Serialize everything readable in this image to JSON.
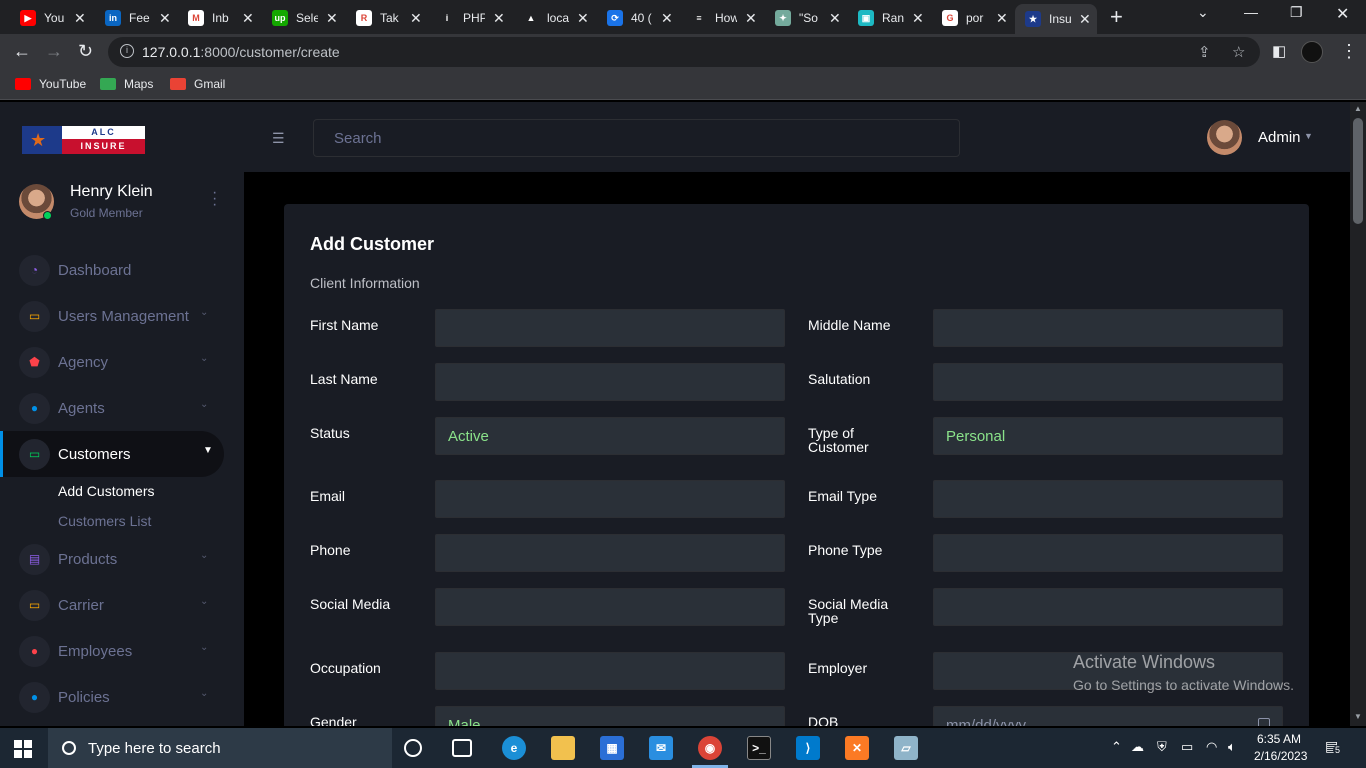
{
  "browser": {
    "tabs": [
      {
        "label": "You",
        "fav_color": "#ff0000",
        "fav_text": "▶"
      },
      {
        "label": "Fee",
        "fav_color": "#0a66c2",
        "fav_text": "in"
      },
      {
        "label": "Inb",
        "fav_color": "#ffffff",
        "fav_text": "M"
      },
      {
        "label": "Sele",
        "fav_color": "#14a800",
        "fav_text": "up"
      },
      {
        "label": "Tak",
        "fav_color": "#ffffff",
        "fav_text": "R"
      },
      {
        "label": "PHP",
        "fav_color": "#202124",
        "fav_text": "i"
      },
      {
        "label": "loca",
        "fav_color": "#202124",
        "fav_text": "▲"
      },
      {
        "label": "40 (",
        "fav_color": "#1a73e8",
        "fav_text": "⟳"
      },
      {
        "label": "How",
        "fav_color": "#202124",
        "fav_text": "≡"
      },
      {
        "label": "\"So",
        "fav_color": "#74aa9c",
        "fav_text": "✦"
      },
      {
        "label": "Ran",
        "fav_color": "#1db9c3",
        "fav_text": "▣"
      },
      {
        "label": "por",
        "fav_color": "#ffffff",
        "fav_text": "G"
      },
      {
        "label": "Insu",
        "fav_color": "#1d3a8a",
        "fav_text": "★"
      }
    ],
    "new_tab": "+",
    "url_host": "127.0.0.1",
    "url_rest": ":8000/customer/create",
    "bookmarks": [
      {
        "label": "YouTube",
        "color": "#ff0000"
      },
      {
        "label": "Maps",
        "color": "#34a853"
      },
      {
        "label": "Gmail",
        "color": "#ea4335"
      }
    ]
  },
  "sidebar": {
    "logo_top": "ALC",
    "logo_bottom": "INSURE",
    "profile_name": "Henry Klein",
    "profile_role": "Gold Member",
    "nav": [
      {
        "label": "Dashboard",
        "icon_color": "#8f5fe8",
        "icon": "◔"
      },
      {
        "label": "Users Management",
        "icon_color": "#ffab00",
        "icon": "▭"
      },
      {
        "label": "Agency",
        "icon_color": "#fc424a",
        "icon": "⬟"
      },
      {
        "label": "Agents",
        "icon_color": "#0090e7",
        "icon": "●"
      },
      {
        "label": "Customers",
        "icon_color": "#00d25b",
        "icon": "▭"
      },
      {
        "label": "Products",
        "icon_color": "#8f5fe8",
        "icon": "▤"
      },
      {
        "label": "Carrier",
        "icon_color": "#ffab00",
        "icon": "▭"
      },
      {
        "label": "Employees",
        "icon_color": "#fc424a",
        "icon": "●"
      },
      {
        "label": "Policies",
        "icon_color": "#0090e7",
        "icon": "●"
      }
    ],
    "sub": {
      "add_customers": "Add Customers",
      "customers_list": "Customers List"
    }
  },
  "topnav": {
    "search_placeholder": "Search",
    "admin_name": "Admin"
  },
  "form": {
    "title": "Add Customer",
    "section": "Client Information",
    "fields": {
      "first_name": {
        "label": "First Name",
        "value": ""
      },
      "middle_name": {
        "label": "Middle Name",
        "value": ""
      },
      "last_name": {
        "label": "Last Name",
        "value": ""
      },
      "salutation": {
        "label": "Salutation",
        "value": ""
      },
      "status": {
        "label": "Status",
        "value": "Active"
      },
      "type_of_customer": {
        "label": "Type of Customer",
        "value": "Personal"
      },
      "email": {
        "label": "Email",
        "value": ""
      },
      "email_type": {
        "label": "Email Type",
        "value": ""
      },
      "phone": {
        "label": "Phone",
        "value": ""
      },
      "phone_type": {
        "label": "Phone Type",
        "value": ""
      },
      "social_media": {
        "label": "Social Media",
        "value": ""
      },
      "social_media_type": {
        "label": "Social Media Type",
        "value": ""
      },
      "occupation": {
        "label": "Occupation",
        "value": ""
      },
      "employer": {
        "label": "Employer",
        "value": ""
      },
      "gender": {
        "label": "Gender",
        "value": "Male"
      },
      "dob": {
        "label": "DOB",
        "placeholder": "mm/dd/yyyy"
      }
    }
  },
  "watermark": {
    "line1": "Activate Windows",
    "line2": "Go to Settings to activate Windows."
  },
  "taskbar": {
    "search_text": "Type here to search",
    "time": "6:35 AM",
    "date": "2/16/2023",
    "notif_count": "5"
  }
}
